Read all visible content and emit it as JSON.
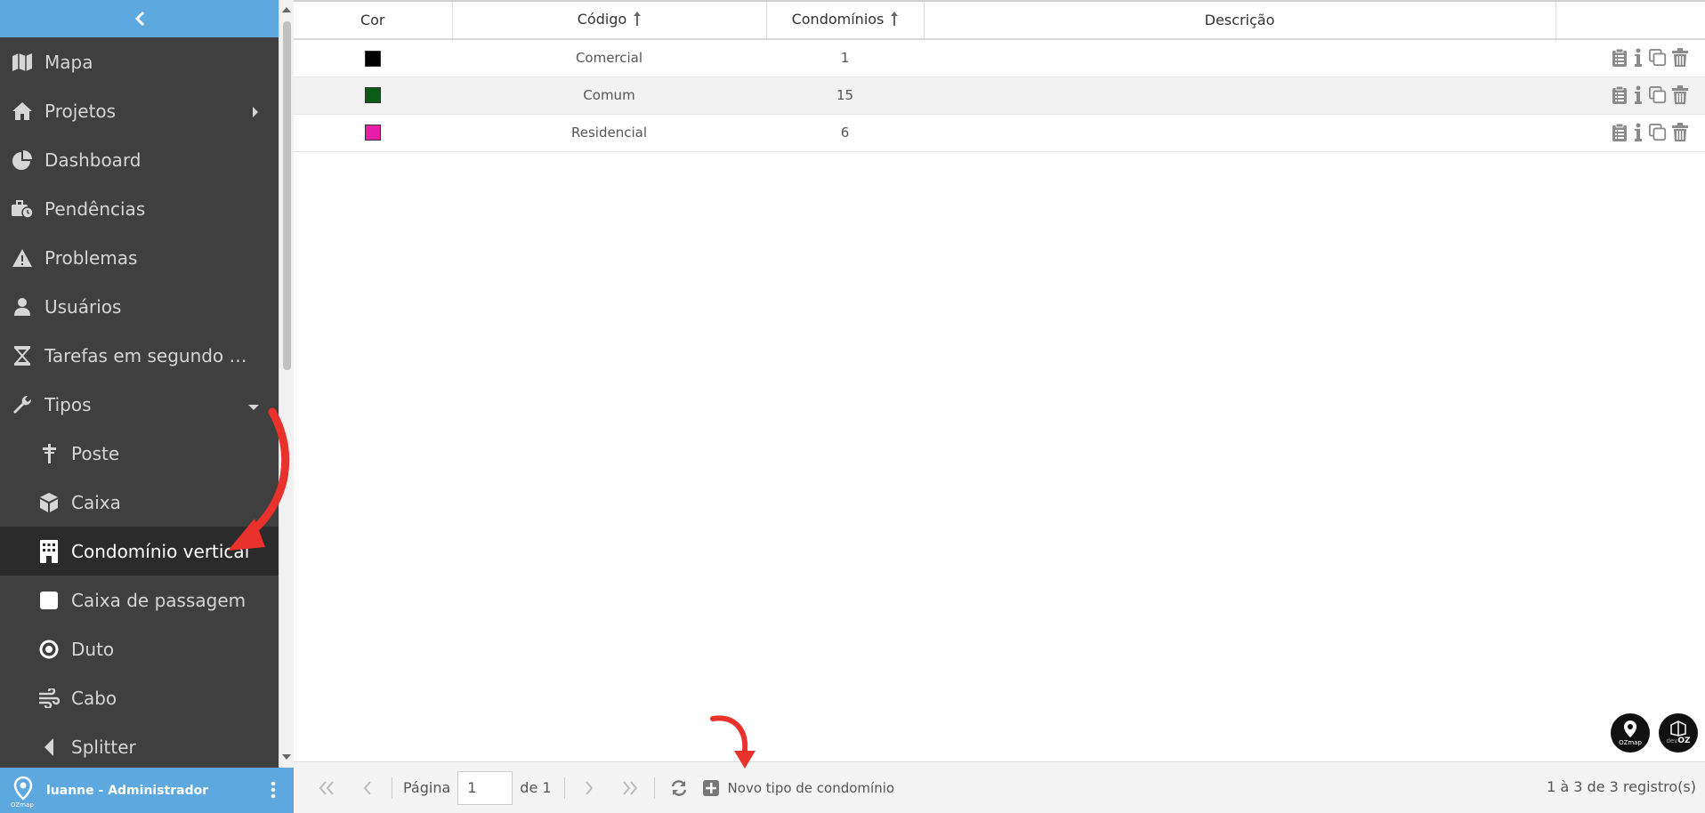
{
  "sidebar": {
    "items": [
      {
        "label": "Mapa",
        "icon": "map-icon"
      },
      {
        "label": "Projetos",
        "icon": "home-icon"
      },
      {
        "label": "Dashboard",
        "icon": "pie-chart-icon"
      },
      {
        "label": "Pendências",
        "icon": "briefcase-clock-icon"
      },
      {
        "label": "Problemas",
        "icon": "warning-icon"
      },
      {
        "label": "Usuários",
        "icon": "user-icon"
      },
      {
        "label": "Tarefas em segundo pl...",
        "icon": "hourglass-icon"
      },
      {
        "label": "Tipos",
        "icon": "wrench-icon"
      }
    ],
    "subitems": [
      {
        "label": "Poste",
        "icon": "pole-icon"
      },
      {
        "label": "Caixa",
        "icon": "cube-icon"
      },
      {
        "label": "Condomínio vertical",
        "icon": "building-icon"
      },
      {
        "label": "Caixa de passagem",
        "icon": "square-icon"
      },
      {
        "label": "Duto",
        "icon": "target-icon"
      },
      {
        "label": "Cabo",
        "icon": "wind-icon"
      },
      {
        "label": "Splitter",
        "icon": "caret-left-icon"
      }
    ]
  },
  "user": {
    "name": "luanne - Administrador",
    "logo_text": "OZmap"
  },
  "table": {
    "headers": {
      "cor": "Cor",
      "codigo": "Código",
      "condominios": "Condomínios",
      "descricao": "Descrição"
    },
    "rows": [
      {
        "color": "#000000",
        "codigo": "Comercial",
        "condominios": "1",
        "descricao": ""
      },
      {
        "color": "#0a5c17",
        "codigo": "Comum",
        "condominios": "15",
        "descricao": ""
      },
      {
        "color": "#e61ea8",
        "codigo": "Residencial",
        "condominios": "6",
        "descricao": ""
      }
    ]
  },
  "footer": {
    "page_label": "Página",
    "page_value": "1",
    "of_label": "de 1",
    "new_label": "Novo tipo de condomínio",
    "count": "1 à 3 de 3 registro(s)"
  },
  "logos": {
    "ozmap": "OZmap",
    "devoz_pre": "dev",
    "devoz": "OZ"
  },
  "colors": {
    "accent": "#5da8df",
    "sidebar_bg": "#3f3f3f",
    "active_bg": "#2b2b2b",
    "annotation": "#e8322b"
  }
}
